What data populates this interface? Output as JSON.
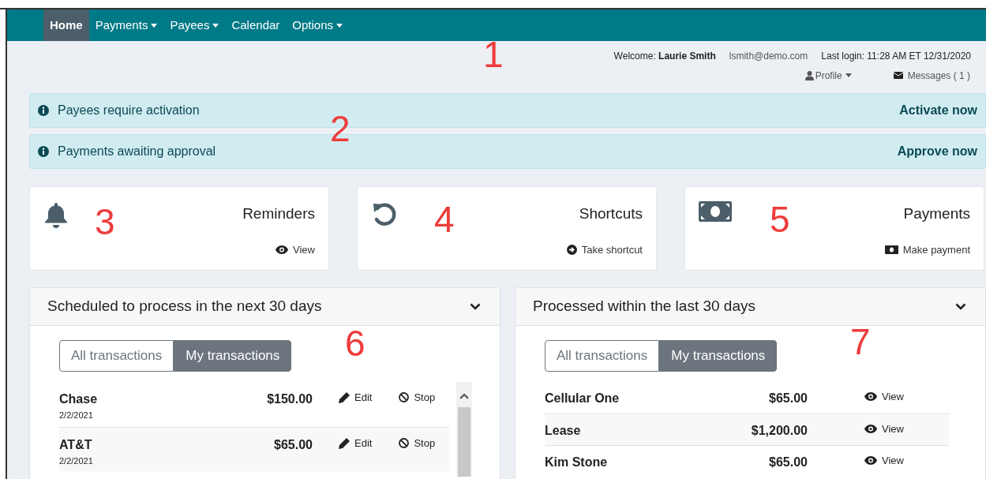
{
  "nav": {
    "items": [
      {
        "label": "Home",
        "selected": true,
        "dropdown": false
      },
      {
        "label": "Payments",
        "selected": false,
        "dropdown": true
      },
      {
        "label": "Payees",
        "selected": false,
        "dropdown": true
      },
      {
        "label": "Calendar",
        "selected": false,
        "dropdown": false
      },
      {
        "label": "Options",
        "selected": false,
        "dropdown": true
      }
    ]
  },
  "user": {
    "welcome_label": "Welcome:",
    "name": "Laurie Smith",
    "email": "lsmith@demo.com",
    "last_login": "Last login: 11:28 AM ET 12/31/2020",
    "profile": "Profile",
    "messages": "Messages ( 1 )"
  },
  "alerts": [
    {
      "message": "Payees require activation",
      "action": "Activate now"
    },
    {
      "message": "Payments awaiting approval",
      "action": "Approve now"
    }
  ],
  "cards": [
    {
      "kind": "bell",
      "title": "Reminders",
      "link": {
        "kind": "eye",
        "label": "View"
      }
    },
    {
      "kind": "undo",
      "title": "Shortcuts",
      "link": {
        "kind": "arrow",
        "label": "Take shortcut"
      }
    },
    {
      "kind": "money",
      "title": "Payments",
      "link": {
        "kind": "money",
        "label": "Make payment"
      }
    }
  ],
  "panels": [
    {
      "title": "Scheduled to process in the next 30 days",
      "expanded": true,
      "scrollbar": true,
      "filters": [
        {
          "label": "All transactions",
          "selected": false
        },
        {
          "label": "My transactions",
          "selected": true
        }
      ],
      "rows": [
        {
          "payee": "Chase",
          "amount": "$150.00",
          "date": "2/2/2021",
          "actions": [
            {
              "kind": "edit",
              "label": "Edit"
            },
            {
              "kind": "stop",
              "label": "Stop"
            }
          ]
        },
        {
          "payee": "AT&T",
          "amount": "$65.00",
          "date": "2/2/2021",
          "actions": [
            {
              "kind": "edit",
              "label": "Edit"
            },
            {
              "kind": "stop",
              "label": "Stop"
            }
          ]
        }
      ]
    },
    {
      "title": "Processed within the last 30 days",
      "expanded": true,
      "scrollbar": false,
      "filters": [
        {
          "label": "All transactions",
          "selected": false
        },
        {
          "label": "My transactions",
          "selected": true
        }
      ],
      "rows": [
        {
          "payee": "Cellular One",
          "amount": "$65.00",
          "actions": [
            {
              "kind": "view",
              "label": "View"
            }
          ]
        },
        {
          "payee": "Lease",
          "amount": "$1,200.00",
          "actions": [
            {
              "kind": "view",
              "label": "View"
            }
          ]
        },
        {
          "payee": "Kim Stone",
          "amount": "$65.00",
          "actions": [
            {
              "kind": "view",
              "label": "View"
            }
          ]
        }
      ]
    }
  ],
  "annotations": [
    {
      "label": "1"
    },
    {
      "label": "2"
    },
    {
      "label": "3"
    },
    {
      "label": "4"
    },
    {
      "label": "5"
    },
    {
      "label": "6"
    },
    {
      "label": "7"
    }
  ]
}
